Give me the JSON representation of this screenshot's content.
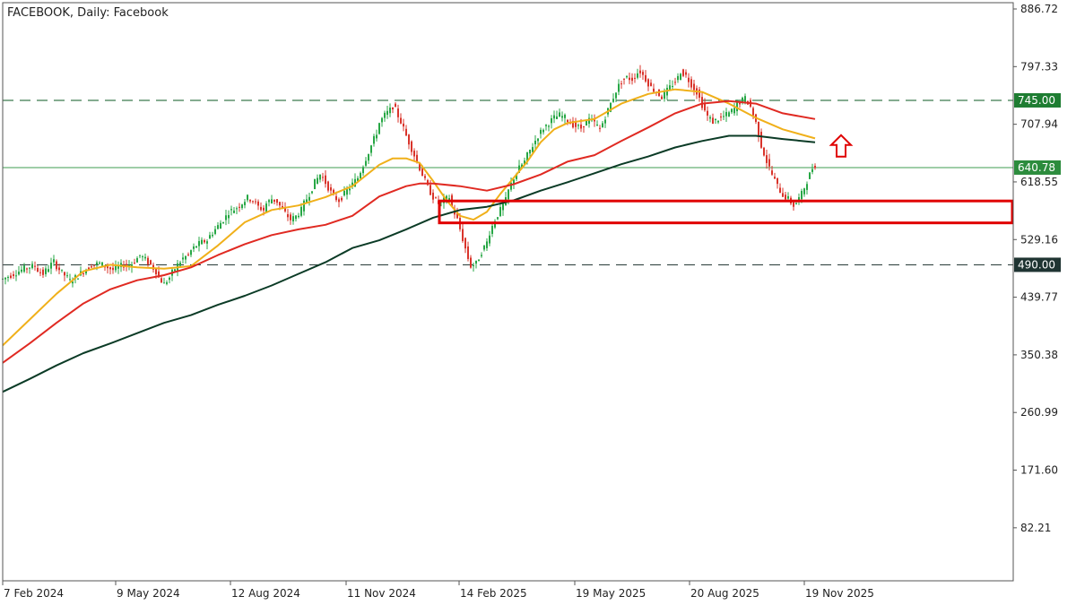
{
  "chart_data": {
    "type": "candlestick",
    "title": "FACEBOOK, Daily:  Facebook",
    "y_ticks": [
      "886.72",
      "797.33",
      "707.94",
      "618.55",
      "529.16",
      "439.77",
      "350.38",
      "260.99",
      "171.60",
      "82.21"
    ],
    "y_tick_values": [
      886.72,
      797.33,
      707.94,
      618.55,
      529.16,
      439.77,
      350.38,
      260.99,
      171.6,
      82.21
    ],
    "ylim": [
      0,
      886.72
    ],
    "x_ticks": [
      "7 Feb 2024",
      "9 May 2024",
      "12 Aug 2024",
      "11 Nov 2024",
      "14 Feb 2025",
      "19 May 2025",
      "20 Aug 2025",
      "19 Nov 2025"
    ],
    "grid": false,
    "levels": [
      {
        "label": "745.00",
        "value": 745.0,
        "style": "dashed",
        "color": "#0b5a20",
        "tag_bg": "#1e7d32"
      },
      {
        "label": "640.78",
        "value": 640.78,
        "style": "solid",
        "color": "#3f9e52",
        "tag_bg": "#2c8c3d"
      },
      {
        "label": "490.00",
        "value": 490.0,
        "style": "dashed",
        "color": "#283a38",
        "tag_bg": "#1f3432"
      }
    ],
    "support_zone": {
      "top": 589,
      "bottom": 555,
      "color": "#e00000"
    },
    "arrow": {
      "direction": "up",
      "color": "#e00000",
      "at_value": 673
    },
    "price_path": [
      [
        0,
        468
      ],
      [
        2,
        472
      ],
      [
        4,
        476
      ],
      [
        6,
        480
      ],
      [
        8,
        484
      ],
      [
        10,
        487
      ],
      [
        12,
        488
      ],
      [
        13,
        482
      ],
      [
        15,
        476
      ],
      [
        17,
        486
      ],
      [
        19,
        495
      ],
      [
        20,
        488
      ],
      [
        22,
        478
      ],
      [
        24,
        470
      ],
      [
        25,
        465
      ],
      [
        27,
        470
      ],
      [
        30,
        480
      ],
      [
        33,
        490
      ],
      [
        36,
        492
      ],
      [
        38,
        488
      ],
      [
        40,
        484
      ],
      [
        41,
        482
      ],
      [
        43,
        486
      ],
      [
        45,
        490
      ],
      [
        46,
        488
      ],
      [
        48,
        492
      ],
      [
        50,
        500
      ],
      [
        51,
        505
      ],
      [
        53,
        498
      ],
      [
        55,
        490
      ],
      [
        57,
        480
      ],
      [
        58,
        470
      ],
      [
        60,
        460
      ],
      [
        62,
        470
      ],
      [
        63,
        478
      ],
      [
        65,
        490
      ],
      [
        67,
        500
      ],
      [
        69,
        505
      ],
      [
        70,
        512
      ],
      [
        72,
        520
      ],
      [
        74,
        525
      ],
      [
        76,
        528
      ],
      [
        77,
        535
      ],
      [
        79,
        545
      ],
      [
        81,
        555
      ],
      [
        83,
        565
      ],
      [
        84,
        572
      ],
      [
        86,
        576
      ],
      [
        88,
        582
      ],
      [
        90,
        590
      ],
      [
        91,
        594
      ],
      [
        93,
        590
      ],
      [
        95,
        580
      ],
      [
        97,
        575
      ],
      [
        98,
        585
      ],
      [
        100,
        592
      ],
      [
        102,
        588
      ],
      [
        104,
        575
      ],
      [
        106,
        565
      ],
      [
        107,
        560
      ],
      [
        109,
        565
      ],
      [
        111,
        575
      ],
      [
        112,
        585
      ],
      [
        114,
        600
      ],
      [
        116,
        618
      ],
      [
        118,
        630
      ],
      [
        119,
        625
      ],
      [
        121,
        610
      ],
      [
        123,
        595
      ],
      [
        125,
        590
      ],
      [
        126,
        595
      ],
      [
        128,
        605
      ],
      [
        130,
        615
      ],
      [
        132,
        625
      ],
      [
        133,
        635
      ],
      [
        135,
        655
      ],
      [
        137,
        675
      ],
      [
        139,
        695
      ],
      [
        140,
        710
      ],
      [
        142,
        722
      ],
      [
        144,
        730
      ],
      [
        145,
        736
      ],
      [
        146,
        730
      ],
      [
        148,
        712
      ],
      [
        150,
        690
      ],
      [
        152,
        670
      ],
      [
        154,
        650
      ],
      [
        156,
        630
      ],
      [
        158,
        610
      ],
      [
        160,
        595
      ],
      [
        162,
        585
      ],
      [
        164,
        590
      ],
      [
        166,
        595
      ],
      [
        167,
        580
      ],
      [
        169,
        560
      ],
      [
        171,
        530
      ],
      [
        173,
        500
      ],
      [
        174,
        488
      ],
      [
        176,
        492
      ],
      [
        178,
        510
      ],
      [
        180,
        525
      ],
      [
        181,
        540
      ],
      [
        183,
        560
      ],
      [
        185,
        575
      ],
      [
        187,
        590
      ],
      [
        188,
        605
      ],
      [
        190,
        625
      ],
      [
        192,
        640
      ],
      [
        194,
        650
      ],
      [
        195,
        660
      ],
      [
        197,
        675
      ],
      [
        199,
        690
      ],
      [
        201,
        702
      ],
      [
        203,
        710
      ],
      [
        205,
        718
      ],
      [
        207,
        722
      ],
      [
        209,
        718
      ],
      [
        211,
        710
      ],
      [
        213,
        705
      ],
      [
        215,
        702
      ],
      [
        216,
        708
      ],
      [
        218,
        715
      ],
      [
        220,
        710
      ],
      [
        222,
        700
      ],
      [
        224,
        720
      ],
      [
        226,
        740
      ],
      [
        228,
        760
      ],
      [
        230,
        775
      ],
      [
        232,
        780
      ],
      [
        234,
        778
      ],
      [
        236,
        788
      ],
      [
        237,
        790
      ],
      [
        239,
        778
      ],
      [
        241,
        765
      ],
      [
        243,
        758
      ],
      [
        245,
        750
      ],
      [
        247,
        760
      ],
      [
        249,
        770
      ],
      [
        251,
        780
      ],
      [
        252,
        790
      ],
      [
        254,
        783
      ],
      [
        256,
        770
      ],
      [
        258,
        758
      ],
      [
        260,
        738
      ],
      [
        262,
        720
      ],
      [
        264,
        712
      ],
      [
        266,
        716
      ],
      [
        268,
        720
      ],
      [
        270,
        725
      ],
      [
        272,
        732
      ],
      [
        273,
        740
      ],
      [
        275,
        745
      ],
      [
        276,
        748
      ],
      [
        278,
        735
      ],
      [
        280,
        710
      ],
      [
        282,
        675
      ],
      [
        284,
        650
      ],
      [
        286,
        630
      ],
      [
        288,
        612
      ],
      [
        290,
        598
      ],
      [
        292,
        592
      ],
      [
        294,
        582
      ],
      [
        295,
        586
      ],
      [
        297,
        600
      ],
      [
        299,
        620
      ],
      [
        301,
        640
      ],
      [
        302,
        645
      ]
    ],
    "moving_averages": [
      {
        "color": "#f0b01a",
        "points": [
          [
            0,
            365
          ],
          [
            10,
            405
          ],
          [
            20,
            445
          ],
          [
            30,
            480
          ],
          [
            40,
            490
          ],
          [
            50,
            486
          ],
          [
            60,
            484
          ],
          [
            70,
            488
          ],
          [
            80,
            520
          ],
          [
            90,
            556
          ],
          [
            100,
            575
          ],
          [
            110,
            582
          ],
          [
            120,
            595
          ],
          [
            130,
            612
          ],
          [
            140,
            645
          ],
          [
            145,
            655
          ],
          [
            150,
            655
          ],
          [
            155,
            648
          ],
          [
            160,
            620
          ],
          [
            165,
            590
          ],
          [
            170,
            566
          ],
          [
            175,
            560
          ],
          [
            180,
            572
          ],
          [
            185,
            600
          ],
          [
            190,
            625
          ],
          [
            195,
            650
          ],
          [
            200,
            680
          ],
          [
            205,
            700
          ],
          [
            210,
            710
          ],
          [
            220,
            716
          ],
          [
            230,
            740
          ],
          [
            240,
            755
          ],
          [
            250,
            762
          ],
          [
            260,
            758
          ],
          [
            270,
            740
          ],
          [
            280,
            718
          ],
          [
            290,
            700
          ],
          [
            302,
            686
          ]
        ]
      },
      {
        "color": "#e02a22",
        "points": [
          [
            0,
            338
          ],
          [
            10,
            368
          ],
          [
            20,
            400
          ],
          [
            30,
            430
          ],
          [
            40,
            452
          ],
          [
            50,
            466
          ],
          [
            60,
            474
          ],
          [
            70,
            486
          ],
          [
            80,
            505
          ],
          [
            90,
            522
          ],
          [
            100,
            536
          ],
          [
            110,
            545
          ],
          [
            120,
            552
          ],
          [
            130,
            566
          ],
          [
            140,
            596
          ],
          [
            150,
            612
          ],
          [
            155,
            616
          ],
          [
            160,
            616
          ],
          [
            170,
            612
          ],
          [
            180,
            605
          ],
          [
            190,
            615
          ],
          [
            200,
            630
          ],
          [
            210,
            650
          ],
          [
            220,
            660
          ],
          [
            230,
            682
          ],
          [
            240,
            703
          ],
          [
            250,
            725
          ],
          [
            260,
            740
          ],
          [
            270,
            744
          ],
          [
            280,
            740
          ],
          [
            290,
            725
          ],
          [
            302,
            716
          ]
        ]
      },
      {
        "color": "#0b3b26",
        "points": [
          [
            0,
            293
          ],
          [
            10,
            313
          ],
          [
            20,
            334
          ],
          [
            30,
            353
          ],
          [
            40,
            368
          ],
          [
            50,
            384
          ],
          [
            60,
            400
          ],
          [
            70,
            412
          ],
          [
            80,
            428
          ],
          [
            90,
            442
          ],
          [
            100,
            458
          ],
          [
            110,
            476
          ],
          [
            120,
            494
          ],
          [
            130,
            516
          ],
          [
            140,
            528
          ],
          [
            150,
            545
          ],
          [
            160,
            563
          ],
          [
            170,
            575
          ],
          [
            180,
            580
          ],
          [
            190,
            590
          ],
          [
            200,
            605
          ],
          [
            210,
            618
          ],
          [
            220,
            632
          ],
          [
            230,
            646
          ],
          [
            240,
            658
          ],
          [
            250,
            672
          ],
          [
            260,
            682
          ],
          [
            270,
            690
          ],
          [
            280,
            690
          ],
          [
            290,
            685
          ],
          [
            302,
            680
          ]
        ]
      }
    ]
  }
}
